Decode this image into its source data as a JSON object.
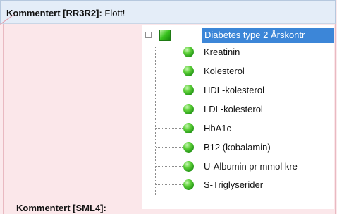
{
  "comment_top": {
    "author": "Kommentert [RR3R2]:",
    "text": " Flott!"
  },
  "comment_bottom": {
    "author": "Kommentert [SML4]:"
  },
  "tree": {
    "root": {
      "label": "Diabetes type 2 Årskontr"
    },
    "items": [
      {
        "label": "Kreatinin"
      },
      {
        "label": "Kolesterol"
      },
      {
        "label": "HDL-kolesterol"
      },
      {
        "label": "LDL-kolesterol"
      },
      {
        "label": "HbA1c"
      },
      {
        "label": "B12 (kobalamin)"
      },
      {
        "label": "U-Albumin pr mmol kre"
      },
      {
        "label": "S-Triglyserider"
      }
    ]
  }
}
